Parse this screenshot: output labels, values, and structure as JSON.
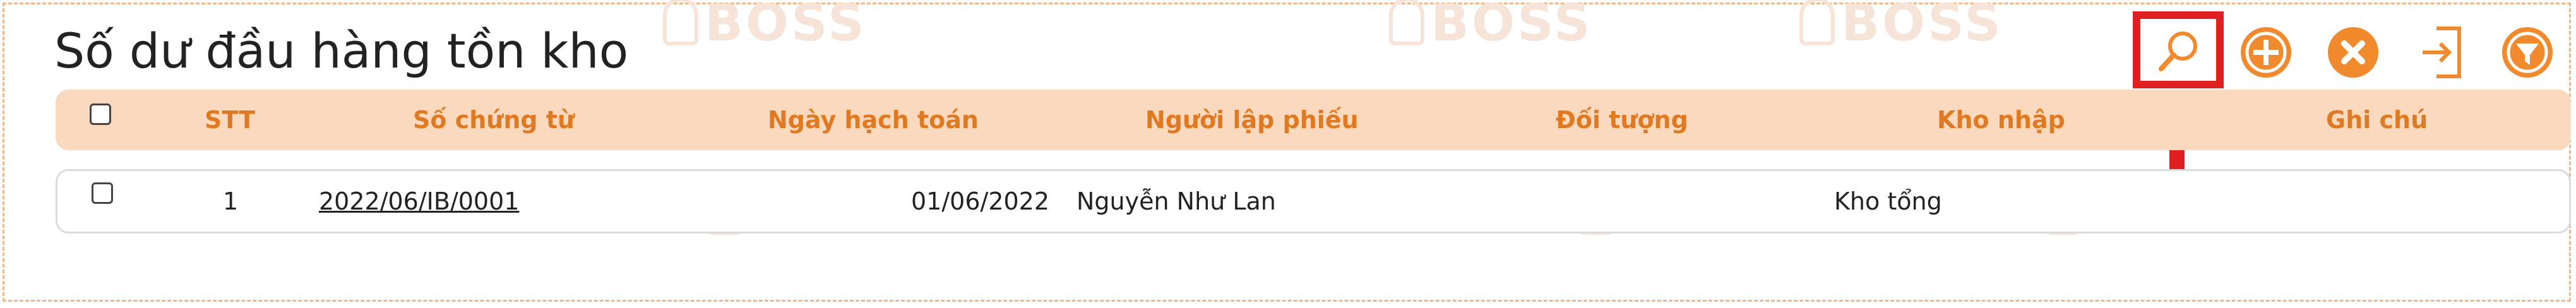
{
  "page": {
    "title": "Số dư đầu hàng tồn kho",
    "watermark_text": "BOSS"
  },
  "toolbar": {
    "buttons": [
      {
        "name": "search",
        "icon": "search-icon",
        "highlighted": true
      },
      {
        "name": "add",
        "icon": "plus-circle-icon"
      },
      {
        "name": "delete",
        "icon": "x-circle-icon"
      },
      {
        "name": "export",
        "icon": "export-icon"
      },
      {
        "name": "filter",
        "icon": "filter-icon"
      }
    ]
  },
  "table": {
    "columns": [
      "STT",
      "Số chứng từ",
      "Ngày hạch toán",
      "Người lập phiếu",
      "Đối tượng",
      "Kho nhập",
      "Ghi chú"
    ],
    "rows": [
      {
        "stt": "1",
        "so_chung_tu": "2022/06/IB/0001",
        "ngay_hach_toan": "01/06/2022",
        "nguoi_lap_phieu": "Nguyễn Như Lan",
        "doi_tuong": "",
        "kho_nhap": "Kho tổng",
        "ghi_chu": ""
      }
    ]
  },
  "colors": {
    "accent": "#f08a2c",
    "header_bg": "#fbd9bf",
    "header_text": "#e07a22",
    "highlight": "#e02020"
  }
}
